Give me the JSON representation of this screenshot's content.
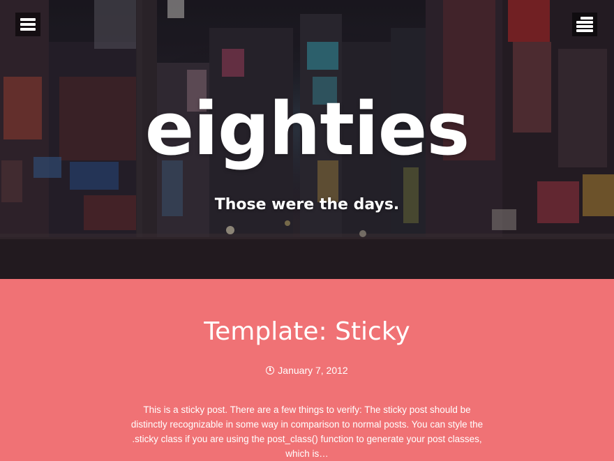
{
  "site": {
    "title": "eighties",
    "tagline": "Those were the days."
  },
  "header": {
    "left_menu_icon": "hamburger-menu-icon",
    "right_menu_icon": "sidebar-menu-icon"
  },
  "post": {
    "title": "Template: Sticky",
    "date_icon": "clock-icon",
    "date": "January 7, 2012",
    "excerpt": "This is a sticky post. There are a few things to verify: The sticky post should be distinctly recognizable in some way in comparison to normal posts. You can style the .sticky class if you are using the post_class() function to generate your post classes, which is…"
  },
  "colors": {
    "accent": "#f07275",
    "text": "#ffffff",
    "button_bg": "#000000"
  }
}
